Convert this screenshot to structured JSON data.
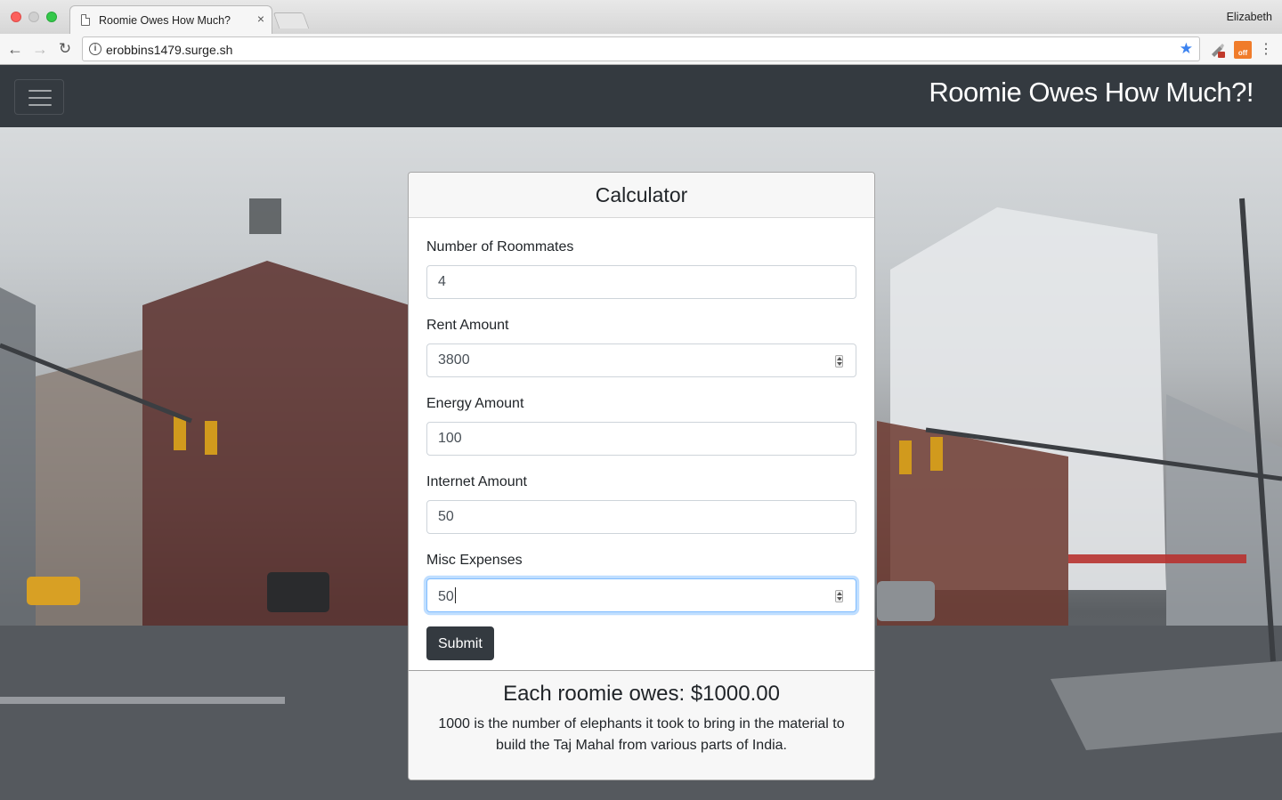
{
  "browser": {
    "tab_title": "Roomie Owes How Much?",
    "tab_close": "×",
    "profile_name": "Elizabeth",
    "url": "erobbins1479.surge.sh",
    "ext_label": "off"
  },
  "navbar": {
    "brand": "Roomie Owes How Much?!"
  },
  "calculator": {
    "title": "Calculator",
    "fields": [
      {
        "label": "Number of Roommates",
        "value": "4"
      },
      {
        "label": "Rent Amount",
        "value": "3800"
      },
      {
        "label": "Energy Amount",
        "value": "100"
      },
      {
        "label": "Internet Amount",
        "value": "50"
      },
      {
        "label": "Misc Expenses",
        "value": "50"
      }
    ],
    "submit_label": "Submit"
  },
  "result": {
    "headline": "Each roomie owes: $1000.00",
    "fact": "1000 is the number of elephants it took to bring in the material to build the Taj Mahal from various parts of India."
  },
  "colors": {
    "navbar": "#343a40",
    "button": "#343a40",
    "focus_border": "#80bdff"
  }
}
